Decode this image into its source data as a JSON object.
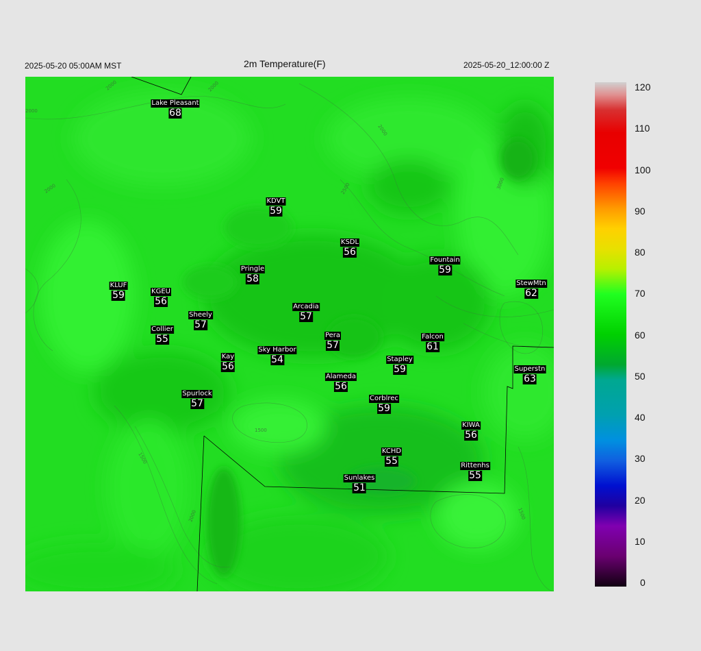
{
  "header": {
    "local_time": "2025-05-20 05:00AM MST",
    "title": "2m Temperature(F)",
    "valid_time": "2025-05-20_12:00:00 Z"
  },
  "stations": [
    {
      "name": "Lake Pleasant",
      "value": "68"
    },
    {
      "name": "KDVT",
      "value": "59"
    },
    {
      "name": "KSDL",
      "value": "56"
    },
    {
      "name": "Fountain",
      "value": "59"
    },
    {
      "name": "Pringle",
      "value": "58"
    },
    {
      "name": "KLUF",
      "value": "59"
    },
    {
      "name": "KGEU",
      "value": "56"
    },
    {
      "name": "StewMtn",
      "value": "62"
    },
    {
      "name": "Arcadia",
      "value": "57"
    },
    {
      "name": "Sheely",
      "value": "57"
    },
    {
      "name": "Collier",
      "value": "55"
    },
    {
      "name": "Pera",
      "value": "57"
    },
    {
      "name": "Falcon",
      "value": "61"
    },
    {
      "name": "Kay",
      "value": "56"
    },
    {
      "name": "Sky Harbor",
      "value": "54"
    },
    {
      "name": "Stapley",
      "value": "59"
    },
    {
      "name": "Superstn",
      "value": "63"
    },
    {
      "name": "Alameda",
      "value": "56"
    },
    {
      "name": "Spurlock",
      "value": "57"
    },
    {
      "name": "Corblrec",
      "value": "59"
    },
    {
      "name": "KIWA",
      "value": "56"
    },
    {
      "name": "KCHD",
      "value": "55"
    },
    {
      "name": "Rittenhs",
      "value": "55"
    },
    {
      "name": "Sunlakes",
      "value": "51"
    }
  ],
  "contour_labels": [
    "2000",
    "2000",
    "2000",
    "2000",
    "2000",
    "2500",
    "1500",
    "1500",
    "1500",
    "2000",
    "3000"
  ],
  "colorbar": {
    "ticks": [
      "120",
      "110",
      "100",
      "90",
      "80",
      "70",
      "60",
      "50",
      "40",
      "30",
      "20",
      "10",
      "0"
    ],
    "min": 0,
    "max": 120
  },
  "colors": {
    "background": "#e5e5e5",
    "map_base": "#1fdc1f",
    "map_warm": "#30ef30",
    "map_cool": "#13c318"
  }
}
